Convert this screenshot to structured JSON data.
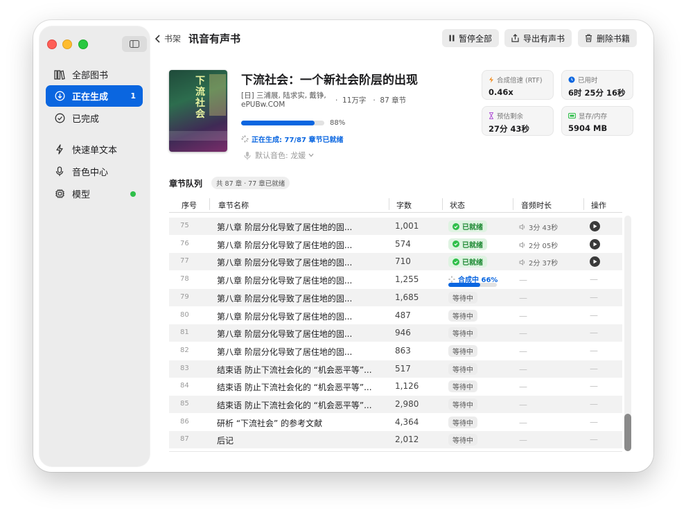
{
  "window": {
    "back_label": "书架",
    "title": "讯音有声书"
  },
  "toolbar": {
    "pause_all": "暂停全部",
    "export": "导出有声书",
    "delete": "删除书籍"
  },
  "sidebar": {
    "items": [
      {
        "label": "全部图书",
        "icon": "books-icon"
      },
      {
        "label": "正在生成",
        "icon": "download-icon",
        "badge": "1",
        "active": true
      },
      {
        "label": "已完成",
        "icon": "check-circle-icon"
      },
      {
        "label": "快速单文本",
        "icon": "bolt-icon"
      },
      {
        "label": "音色中心",
        "icon": "microphone-icon"
      },
      {
        "label": "模型",
        "icon": "chip-icon",
        "status_color": "#2fbf4a"
      }
    ]
  },
  "book": {
    "title": "下流社会：一个新社会阶层的出现",
    "author": "[日] 三浦展, 陆求实, 戴铮,",
    "publisher": "ePUBw.COM",
    "word_count": "11万字",
    "chapter_count": "87 章节",
    "progress": 0.88,
    "progress_label": "88%",
    "generation_status": "正在生成: 77/87 章节已就绪",
    "voice": "默认音色: 龙媛",
    "cover_text": "下流社会"
  },
  "stats": {
    "rtf": {
      "label": "合成倍速 (RTF)",
      "value": "0.46x",
      "color": "#f08a1c"
    },
    "elapsed": {
      "label": "已用时",
      "value": "6时 25分 16秒",
      "color": "#0a66e0"
    },
    "remaining": {
      "label": "预估剩余",
      "value": "27分 43秒",
      "color": "#b45ad8"
    },
    "memory": {
      "label": "显存/内存",
      "value": "5904 MB",
      "color": "#2fbf4a"
    }
  },
  "queue": {
    "title": "章节队列",
    "summary": "共 87 章 · 77 章已就绪",
    "columns": [
      "序号",
      "章节名称",
      "字数",
      "状态",
      "音频时长",
      "操作"
    ],
    "rows": [
      {
        "idx": "75",
        "name": "第八章 阶层分化导致了居住地的固...",
        "words": "1,001",
        "status": "ready",
        "status_label": "已就绪",
        "duration": "3分 43秒"
      },
      {
        "idx": "76",
        "name": "第八章 阶层分化导致了居住地的固...",
        "words": "574",
        "status": "ready",
        "status_label": "已就绪",
        "duration": "2分 05秒"
      },
      {
        "idx": "77",
        "name": "第八章 阶层分化导致了居住地的固...",
        "words": "710",
        "status": "ready",
        "status_label": "已就绪",
        "duration": "2分 37秒"
      },
      {
        "idx": "78",
        "name": "第八章 阶层分化导致了居住地的固...",
        "words": "1,255",
        "status": "synth",
        "status_label": "合成中 66%",
        "progress": 0.66,
        "duration": "—"
      },
      {
        "idx": "79",
        "name": "第八章 阶层分化导致了居住地的固...",
        "words": "1,685",
        "status": "wait",
        "status_label": "等待中",
        "duration": "—"
      },
      {
        "idx": "80",
        "name": "第八章 阶层分化导致了居住地的固...",
        "words": "487",
        "status": "wait",
        "status_label": "等待中",
        "duration": "—"
      },
      {
        "idx": "81",
        "name": "第八章 阶层分化导致了居住地的固...",
        "words": "946",
        "status": "wait",
        "status_label": "等待中",
        "duration": "—"
      },
      {
        "idx": "82",
        "name": "第八章 阶层分化导致了居住地的固...",
        "words": "863",
        "status": "wait",
        "status_label": "等待中",
        "duration": "—"
      },
      {
        "idx": "83",
        "name": "结束语 防止下流社会化的 “机会恶平等”...",
        "words": "517",
        "status": "wait",
        "status_label": "等待中",
        "duration": "—"
      },
      {
        "idx": "84",
        "name": "结束语 防止下流社会化的 “机会恶平等”...",
        "words": "1,126",
        "status": "wait",
        "status_label": "等待中",
        "duration": "—"
      },
      {
        "idx": "85",
        "name": "结束语 防止下流社会化的 “机会恶平等”...",
        "words": "2,980",
        "status": "wait",
        "status_label": "等待中",
        "duration": "—"
      },
      {
        "idx": "86",
        "name": "研析 “下流社会” 的参考文献",
        "words": "4,364",
        "status": "wait",
        "status_label": "等待中",
        "duration": "—"
      },
      {
        "idx": "87",
        "name": "后记",
        "words": "2,012",
        "status": "wait",
        "status_label": "等待中",
        "duration": "—"
      }
    ]
  }
}
